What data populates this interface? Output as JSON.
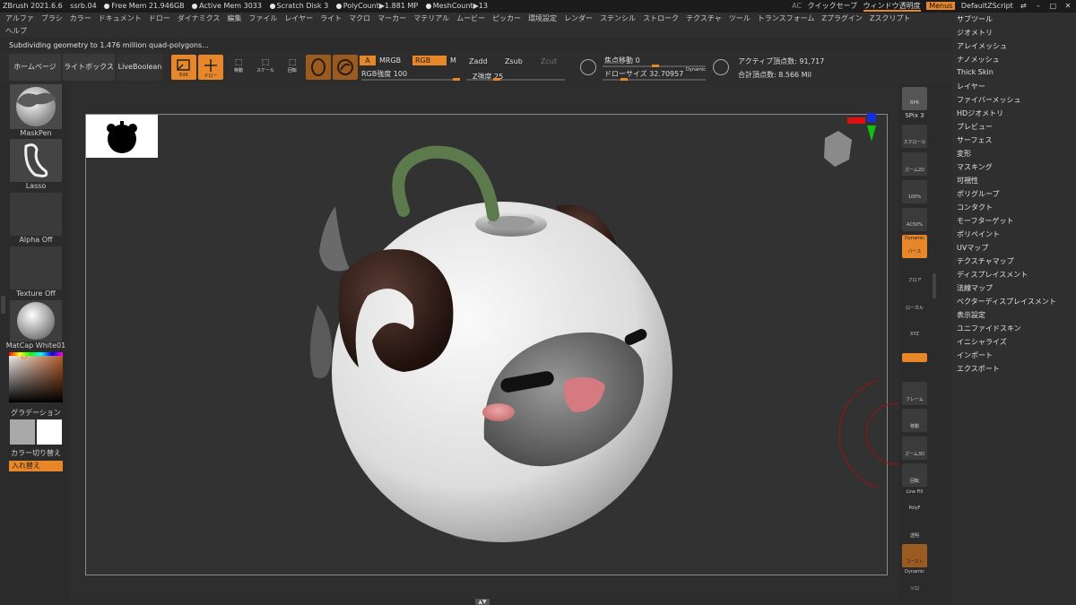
{
  "titlebar": {
    "app": "ZBrush 2021.6.6",
    "doc": "ssrb.04",
    "free_mem": "Free Mem 21.946GB",
    "active_mem": "Active Mem 3033",
    "scratch": "Scratch Disk 3",
    "polycount": "PolyCount▶1.881 MP",
    "meshcount": "MeshCount▶13",
    "ac": "AC",
    "quicksave": "クイックセーブ",
    "window_transparency": "ウィンドウ透明度",
    "menus": "Menus",
    "zscript": "DefaultZScript"
  },
  "menubar": {
    "row1": [
      "アルファ",
      "ブラシ",
      "カラー",
      "ドキュメント",
      "ドロー",
      "ダイナミクス",
      "編集",
      "ファイル",
      "レイヤー",
      "ライト",
      "マクロ",
      "マーカー",
      "マテリアル",
      "ムービー",
      "ピッカー",
      "環境設定",
      "レンダー",
      "ステンシル",
      "ストローク",
      "テクスチャ",
      "ツール",
      "トランスフォーム",
      "Zプラグイン",
      "Zスクリプト"
    ],
    "row2": [
      "ヘルプ"
    ]
  },
  "status": "Subdividing geometry to 1.476 million quad-polygons...",
  "toolbar": {
    "homepage": "ホームページ",
    "lightbox": "ライトボックス",
    "liveboolean": "LiveBoolean",
    "edit": "Edit",
    "draw": "ドロー",
    "move": "移動",
    "scale": "スケール",
    "rotate": "回転",
    "a_label": "A",
    "mrgb": "MRGB",
    "rgb": "RGB",
    "m_label": "M",
    "rgb_intensity": "RGB強度 100",
    "zadd": "Zadd",
    "zsub": "Zsub",
    "zcut": "Zcut",
    "z_intensity": "Z強度 25",
    "focal_shift": "焦点移動 0",
    "draw_size": "ドローサイズ 32.70957",
    "dynamic": "Dynamic",
    "active_points": "アクティブ頂点数: 91,717",
    "total_points": "合計頂点数: 8.566 Mil"
  },
  "left_shelf": {
    "brush": "MaskPen",
    "stroke": "Lasso",
    "alpha": "Alpha Off",
    "texture": "Texture Off",
    "material": "MatCap White01",
    "gradient": "グラデーション",
    "switch_color": "カラー切り替え",
    "swap": "入れ替え"
  },
  "right_shelf": {
    "bpr": "BPR",
    "spix": "SPix 3",
    "scroll": "スクロール",
    "zoom2d": "ズーム2D",
    "pct100": "100%",
    "ac50": "AC50%",
    "dynamic_persp": "Dynamic",
    "persp": "パース",
    "floor": "フロア",
    "local": "ローカル",
    "xyz": "XYZ",
    "frame": "フレーム",
    "move": "移動",
    "zoom3d": "ズーム3D",
    "rotate": "回転",
    "linefill": "Line Fill",
    "polyf": "PolyF",
    "transp": "透明",
    "ghost": "ゴースト",
    "dynamic_solo": "Dynamic",
    "solo": "ソロ"
  },
  "right_menu": [
    "サブツール",
    "ジオメトリ",
    "アレイメッシュ",
    "ナノメッシュ",
    "Thick Skin",
    "レイヤー",
    "ファイバーメッシュ",
    "HDジオメトリ",
    "プレビュー",
    "サーフェス",
    "変形",
    "マスキング",
    "可視性",
    "ポリグループ",
    "コンタクト",
    "モーフターゲット",
    "ポリペイント",
    "UVマップ",
    "テクスチャマップ",
    "ディスプレイスメント",
    "法線マップ",
    "ベクターディスプレイスメント",
    "表示設定",
    "ユニファイドスキン",
    "イニシャライズ",
    "インポート",
    "エクスポート"
  ],
  "colors": {
    "accent": "#e8872a",
    "bg": "#2b2b2b",
    "panel": "#3a3a3a"
  }
}
